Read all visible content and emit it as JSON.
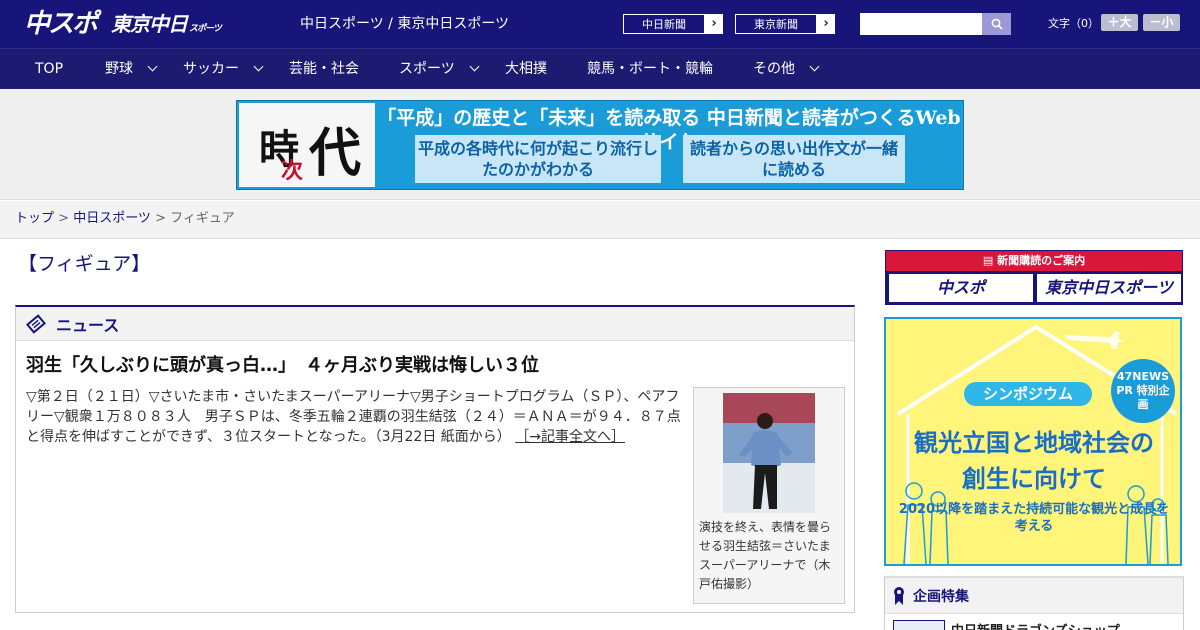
{
  "header": {
    "logo_chuspo": "中スポ",
    "logo_tokyo": "東京中日",
    "logo_tokyo_sub": "スポーツ",
    "site_names": "中日スポーツ / 東京中日スポーツ",
    "link1": "中日新聞",
    "link2": "東京新聞",
    "search_placeholder": "",
    "font_size_label": "文字（0）",
    "font_plus": "＋大",
    "font_minus": "－小"
  },
  "nav": {
    "items": [
      "TOP",
      "野球",
      "サッカー",
      "芸能・社会",
      "スポーツ",
      "大相撲",
      "競馬・ボート・競輪",
      "その他"
    ]
  },
  "banner": {
    "kanji1": "時",
    "kanji2": "次",
    "kanji3": "代",
    "headline": "「平成」の歴史と「未来」を読み取る 中日新聞と読者がつくるWebサイト",
    "box1": "平成の各時代に何が起こり流行したのかがわかる",
    "box2": "読者からの思い出作文が一緒に読める"
  },
  "breadcrumb": {
    "top": "トップ",
    "sep": " > ",
    "section": "中日スポーツ",
    "current": "フィギュア"
  },
  "page": {
    "title": "【フィギュア】"
  },
  "news": {
    "heading": "ニュース",
    "article_title": "羽生「久しぶりに頭が真っ白…」　４ヶ月ぶり実戦は悔しい３位",
    "article_body": "▽第２日（２１日）▽さいたま市・さいたまスーパーアリーナ▽男子ショートプログラム（ＳＰ）、ペアフリー▽観衆１万８０８３人　男子ＳＰは、冬季五輪２連覇の羽生結弦（２４）＝ＡＮＡ＝が９４．８７点と得点を伸ばすことができず、３位スタートとなった。（3月22日 紙面から）",
    "more_link": "［→記事全文へ］",
    "photo_caption": "演技を終え、表情を曇らせる羽生結弦＝さいたまスーパーアリーナで（木戸佑撮影）"
  },
  "sidebar": {
    "subscription_heading": "新聞購読のご案内",
    "sub_logo1": "中スポ",
    "sub_logo2": "東京中日スポーツ",
    "ad_badge": "47NEWS PR 特別企画",
    "ad_symposium": "シンポジウム",
    "ad_title1": "観光立国と地域社会の",
    "ad_title2": "創生に向けて",
    "ad_sub": "2020以降を踏まえた持続可能な観光と成長を考える",
    "feature_heading": "企画特集",
    "feature_item": "中日新聞ドラゴンズショップ"
  }
}
